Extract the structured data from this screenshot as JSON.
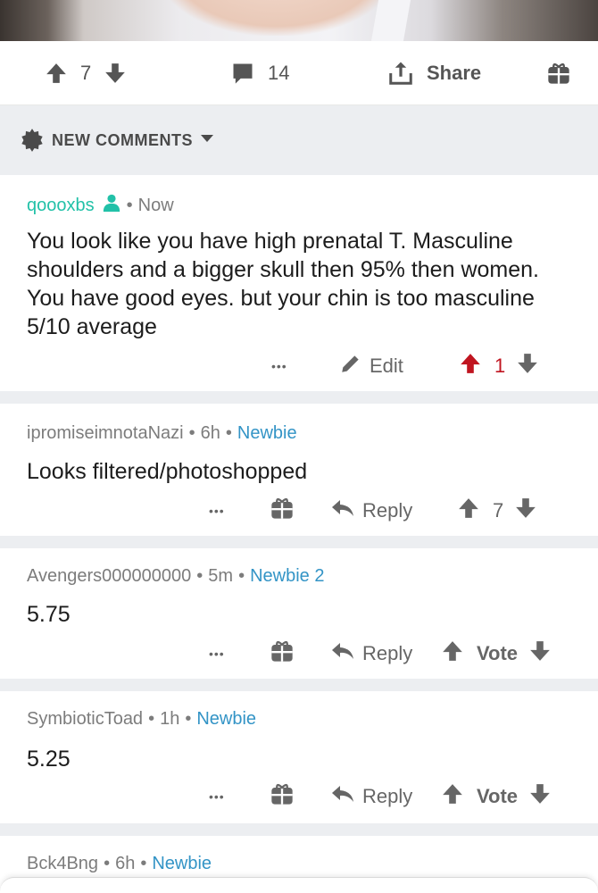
{
  "post_actions": {
    "upvotes": "7",
    "comments": "14",
    "share_label": "Share"
  },
  "sort": {
    "label": "NEW COMMENTS"
  },
  "comments": [
    {
      "author": "qoooxbs",
      "time": "Now",
      "body": "You look like you have high prenatal T. Masculine shoulders and a bigger skull then 95% then women. You have good eyes. but your chin is too masculine 5/10 average",
      "more": "•••",
      "edit_label": "Edit",
      "score": "1"
    },
    {
      "author": "ipromiseimnotaNazi",
      "time": "6h",
      "flair": "Newbie",
      "body": "Looks filtered/photoshopped",
      "more": "•••",
      "reply_label": "Reply",
      "score": "7"
    },
    {
      "author": "Avengers000000000",
      "time": "5m",
      "flair": "Newbie 2",
      "body": "5.75",
      "more": "•••",
      "reply_label": "Reply",
      "score": "Vote"
    },
    {
      "author": "SymbioticToad",
      "time": "1h",
      "flair": "Newbie",
      "body": "5.25",
      "more": "•••",
      "reply_label": "Reply",
      "score": "Vote"
    },
    {
      "author": "Bck4Bng",
      "time": "6h",
      "flair": "Newbie"
    }
  ],
  "colors": {
    "op_author": "#22c1a8",
    "flair": "#3394c6",
    "upvote_active": "#c01520",
    "divider": "#eceef1"
  },
  "icons": [
    "upvote-icon",
    "downvote-icon",
    "comment-icon",
    "share-icon",
    "gift-icon",
    "gear-icon",
    "chevron-down-icon",
    "user-icon",
    "pencil-icon",
    "reply-icon"
  ]
}
